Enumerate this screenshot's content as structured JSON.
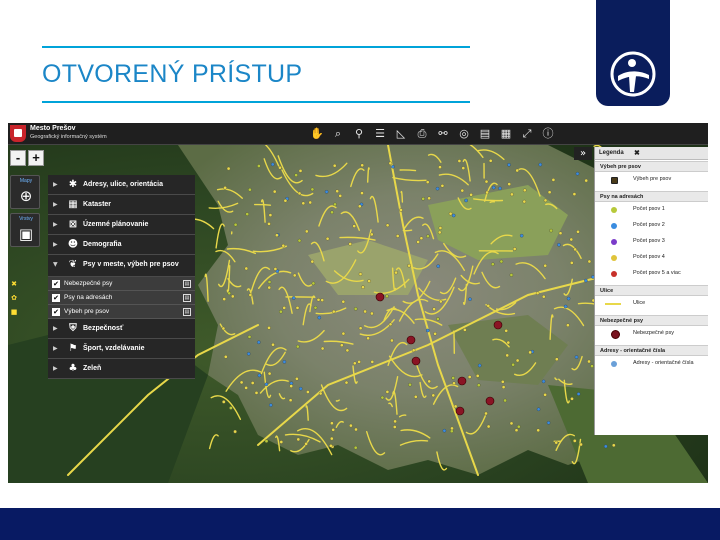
{
  "slide": {
    "title": "OTVORENÝ PRÍSTUP"
  },
  "app": {
    "name": "Mesto Prešov",
    "subtitle": "Geografický informačný systém",
    "toolbar": [
      {
        "icon": "hand-icon",
        "glyph": "✋"
      },
      {
        "icon": "search-icon",
        "glyph": "⌕"
      },
      {
        "icon": "map-pin-icon",
        "glyph": "⚲"
      },
      {
        "icon": "list-icon",
        "glyph": "☰"
      },
      {
        "icon": "measure-icon",
        "glyph": "◺"
      },
      {
        "icon": "print-icon",
        "glyph": "⎙"
      },
      {
        "icon": "link-icon",
        "glyph": "⚯"
      },
      {
        "icon": "globe-icon",
        "glyph": "◎"
      },
      {
        "icon": "layers-list-icon",
        "glyph": "▤"
      },
      {
        "icon": "calendar-icon",
        "glyph": "▦"
      },
      {
        "icon": "fullscreen-icon",
        "glyph": "⤢"
      },
      {
        "icon": "info-icon",
        "glyph": "ⓘ"
      }
    ],
    "zoom": {
      "minus": "-",
      "plus": "+"
    },
    "side_buttons": [
      {
        "label": "Mapy",
        "icon": "globe-icon",
        "glyph": "⊕"
      },
      {
        "label": "Vrstvy",
        "icon": "layers-icon",
        "glyph": "▣"
      }
    ],
    "layers": [
      {
        "label": "Adresy, ulice, orientácia",
        "icon": "marker-icon",
        "glyph": "✱"
      },
      {
        "label": "Kataster",
        "icon": "grid-icon",
        "glyph": "▦"
      },
      {
        "label": "Územné plánovanie",
        "icon": "planning-icon",
        "glyph": "⊠"
      },
      {
        "label": "Demografia",
        "icon": "people-icon",
        "glyph": "☻"
      }
    ],
    "expanded_layer": {
      "label": "Psy v meste, výbeh pre psov",
      "icon": "dog-icon",
      "glyph": "❦",
      "sublayers": [
        {
          "label": "Nebezpečné psy",
          "pre": "✖"
        },
        {
          "label": "Psy na adresách",
          "pre": "✿"
        },
        {
          "label": "Výbeh pre psov",
          "pre": "■"
        }
      ]
    },
    "layers_after": [
      {
        "label": "Bezpečnosť",
        "icon": "shield-icon",
        "glyph": "⛨"
      },
      {
        "label": "Šport, vzdelávanie",
        "icon": "graduation-icon",
        "glyph": "⚑"
      },
      {
        "label": "Zeleň",
        "icon": "tree-icon",
        "glyph": "♣"
      }
    ],
    "legend": {
      "title": "Legenda",
      "close": "✖",
      "collapse": "»",
      "sections": [
        {
          "title": "Výbeh pre psov",
          "items": [
            {
              "label": "Výbeh pre psov",
              "color": "#4a3b1a",
              "shape": "square"
            }
          ]
        },
        {
          "title": "Psy na adresách",
          "items": [
            {
              "label": "Počet psov 1",
              "color": "#b7c93a"
            },
            {
              "label": "Počet psov 2",
              "color": "#3a8ce0"
            },
            {
              "label": "Počet psov 3",
              "color": "#7a3bc9"
            },
            {
              "label": "Počet psov 4",
              "color": "#e0c43a"
            },
            {
              "label": "Počet psov 5 a viac",
              "color": "#c7302a"
            }
          ]
        },
        {
          "title": "Ulice",
          "items": [
            {
              "label": "Ulice",
              "color": "#e8d84a",
              "shape": "line"
            }
          ]
        },
        {
          "title": "Nebezpečné psy",
          "items": [
            {
              "label": "Nebezpečné psy",
              "color": "#7a1420",
              "shape": "big"
            }
          ]
        },
        {
          "title": "Adresy - orientačné čísla",
          "items": [
            {
              "label": "Adresy - orientačné čísla",
              "color": "#6aa0d8"
            }
          ]
        }
      ]
    }
  }
}
